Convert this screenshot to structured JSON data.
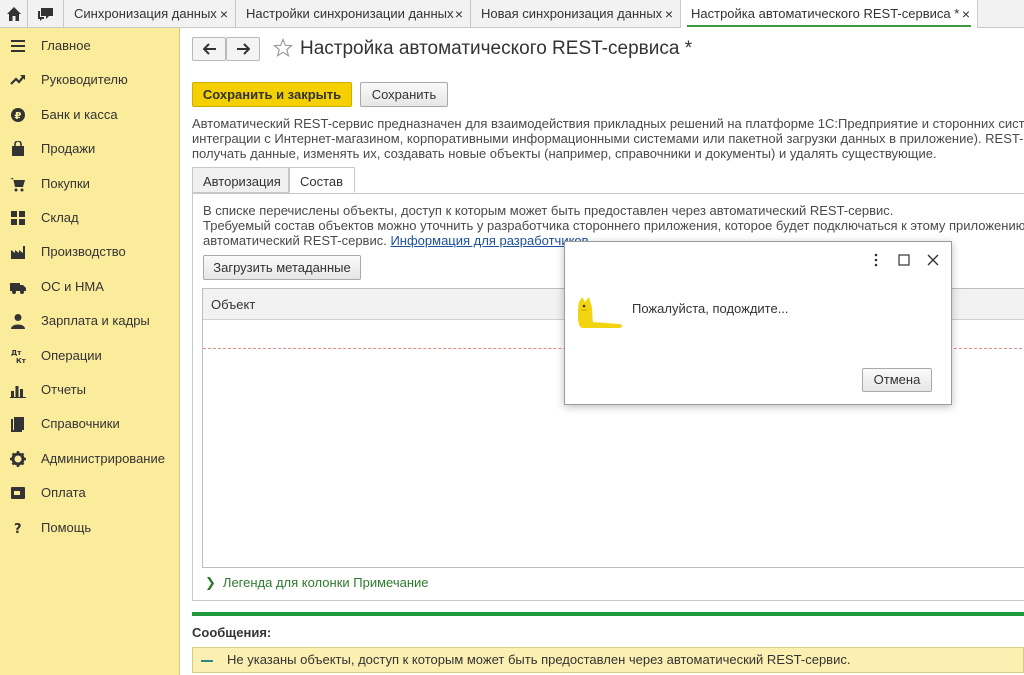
{
  "tabs": {
    "home_icon": "home-icon",
    "chat_icon": "chat-icon",
    "items": [
      {
        "label": "Синхронизация данных"
      },
      {
        "label": "Настройки синхронизации данных"
      },
      {
        "label": "Новая синхронизация данных"
      },
      {
        "label": "Настройка автоматического REST-сервиса *"
      }
    ],
    "close_glyph": "×"
  },
  "sidebar": {
    "items": [
      {
        "label": "Главное",
        "icon": "menu-icon"
      },
      {
        "label": "Руководителю",
        "icon": "trend-icon"
      },
      {
        "label": "Банк и касса",
        "icon": "coin-icon"
      },
      {
        "label": "Продажи",
        "icon": "bag-icon"
      },
      {
        "label": "Покупки",
        "icon": "cart-icon"
      },
      {
        "label": "Склад",
        "icon": "grid-icon"
      },
      {
        "label": "Производство",
        "icon": "factory-icon"
      },
      {
        "label": "ОС и НМА",
        "icon": "truck-icon"
      },
      {
        "label": "Зарплата и кадры",
        "icon": "person-icon"
      },
      {
        "label": "Операции",
        "icon": "dt-kt-icon"
      },
      {
        "label": "Отчеты",
        "icon": "bar-chart-icon"
      },
      {
        "label": "Справочники",
        "icon": "books-icon"
      },
      {
        "label": "Администрирование",
        "icon": "gear-icon"
      },
      {
        "label": "Оплата",
        "icon": "wallet-icon"
      },
      {
        "label": "Помощь",
        "icon": "question-icon"
      }
    ]
  },
  "form": {
    "title": "Настройка автоматического REST-сервиса *",
    "save_close_label": "Сохранить и закрыть",
    "save_label": "Сохранить",
    "description": [
      "Автоматический REST-сервис предназначен для взаимодействия прикладных решений на платформе 1С:Предприятие и сторонних систем",
      "интеграции с Интернет-магазином, корпоративными информационными системами или пакетной загрузки данных в приложение). REST-серв",
      "получать данные, изменять их, создавать новые объекты (например, справочники и документы) и удалять существующие."
    ],
    "tabs": [
      {
        "label": "Авторизация"
      },
      {
        "label": "Состав"
      }
    ],
    "panel_text": [
      "В списке перечислены объекты, доступ к которым может быть предоставлен через автоматический REST-сервис.",
      "Требуемый состав объектов можно уточнить у разработчика стороннего приложения, которое будет подключаться к этому приложению че",
      "автоматический REST-сервис. "
    ],
    "dev_link": "Информация для разработчиков",
    "load_metadata_label": "Загрузить метаданные",
    "grid_column": "Объект",
    "legend_label": "Легенда для колонки Примечание",
    "messages_title": "Сообщения:",
    "message": "Не указаны объекты, доступ к которым может быть предоставлен через автоматический REST-сервис."
  },
  "dialog": {
    "text": "Пожалуйста, подождите...",
    "cancel_label": "Отмена"
  },
  "colors": {
    "sidebar_bg": "#fbec9c",
    "primary_button": "#f5d000",
    "accent_green": "#1f9a3c",
    "message_bg": "#fbf0b2"
  }
}
